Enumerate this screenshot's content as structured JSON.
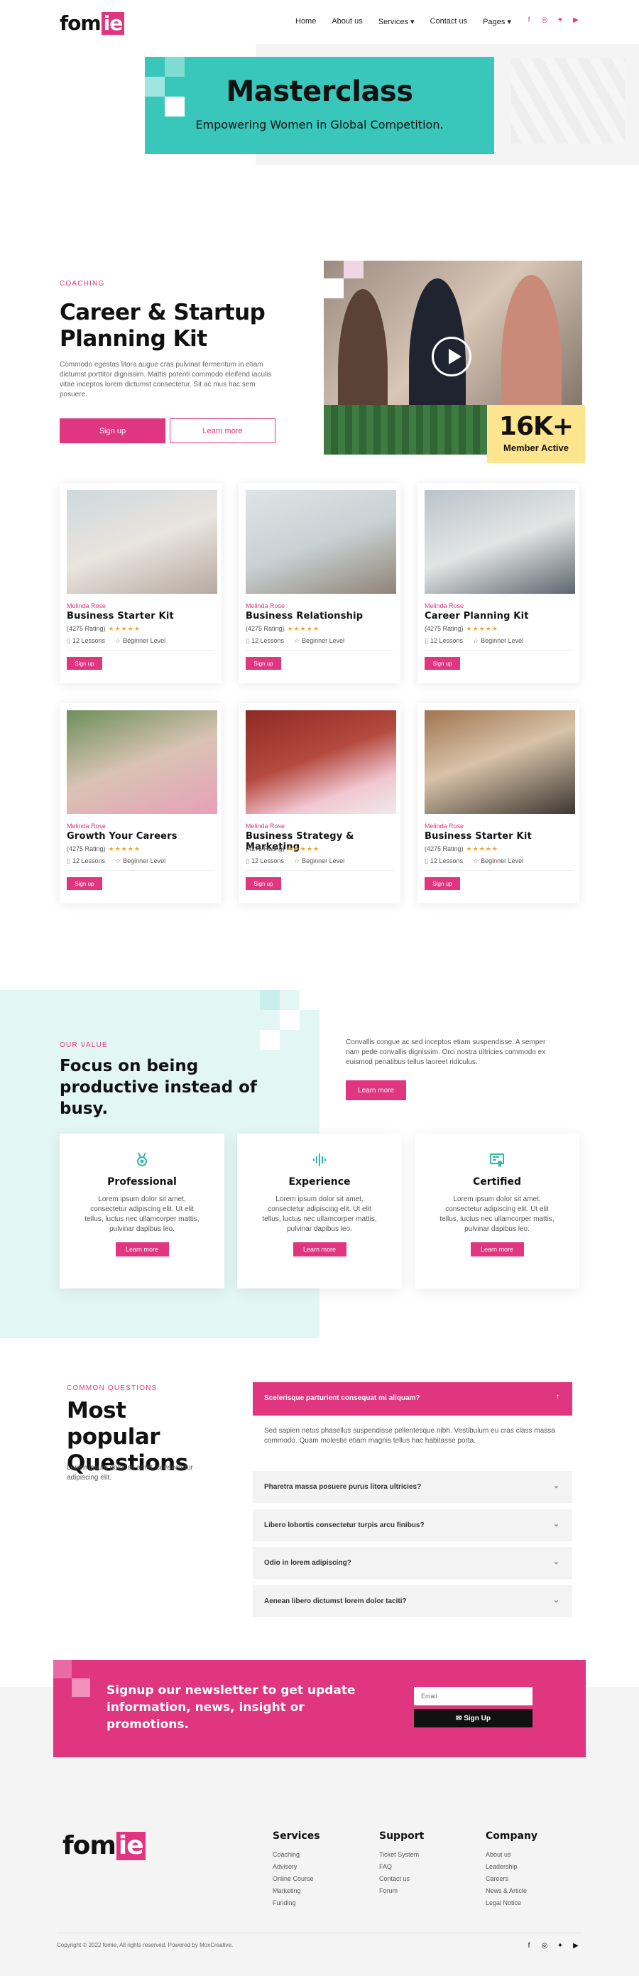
{
  "header": {
    "logo_text": "fom",
    "logo_accent": "ie",
    "nav": [
      {
        "label": "Home"
      },
      {
        "label": "About us"
      },
      {
        "label": "Services ▾"
      },
      {
        "label": "Contact us"
      },
      {
        "label": "Pages ▾"
      }
    ]
  },
  "hero": {
    "title": "Masterclass",
    "subtitle": "Empowering Women in Global Competition."
  },
  "coaching": {
    "eyebrow": "COACHING",
    "title": "Career & Startup Planning Kit",
    "text": "Commodo egestas litora augue cras pulvinar fermentum in etiam dictumst porttitor dignissim. Mattis potenti commodo eleifend iaculis vitae inceptos lorem dictumst consectetur. Sit ac mus hac sem posuere.",
    "primary_button": "Sign up",
    "secondary_button": "Learn more",
    "stat_number": "16K+",
    "stat_label": "Member Active"
  },
  "courses": [
    {
      "author": "Melinda Rose",
      "title": "Business Starter Kit",
      "rating": "(4275 Rating)",
      "stars": "★★★★★",
      "lessons": "12 Lessons",
      "level": "Beginner Level",
      "button": "Sign up"
    },
    {
      "author": "Melinda Rose",
      "title": "Business Relationship",
      "rating": "(4275 Rating)",
      "stars": "★★★★★",
      "lessons": "12 Lessons",
      "level": "Beginner Level",
      "button": "Sign up"
    },
    {
      "author": "Melinda Rose",
      "title": "Career Planning Kit",
      "rating": "(4275 Rating)",
      "stars": "★★★★★",
      "lessons": "12 Lessons",
      "level": "Beginner Level",
      "button": "Sign up"
    },
    {
      "author": "Melinda Rose",
      "title": "Growth Your Careers",
      "rating": "(4275 Rating)",
      "stars": "★★★★★",
      "lessons": "12 Lessons",
      "level": "Beginner Level",
      "button": "Sign up"
    },
    {
      "author": "Melinda Rose",
      "title": "Business Strategy & Marketing",
      "rating": "(4275 Rating)",
      "stars": "★★★★★",
      "lessons": "12 Lessons",
      "level": "Beginner Level",
      "button": "Sign up"
    },
    {
      "author": "Melinda Rose",
      "title": "Business Starter Kit",
      "rating": "(4275 Rating)",
      "stars": "★★★★★",
      "lessons": "12 Lessons",
      "level": "Beginner Level",
      "button": "Sign up"
    }
  ],
  "value": {
    "eyebrow": "OUR VALUE",
    "title": "Focus on being productive instead of busy.",
    "text": "Convallis congue ac sed inceptos etiam suspendisse. A semper nam pede convallis dignissim. Orci nostra ultricies commodo ex euismod penatibus tellus laoreet ridiculus.",
    "button": "Learn more",
    "cards": [
      {
        "icon": "medal-icon",
        "title": "Professional",
        "text": "Lorem ipsum dolor sit amet, consectetur adipiscing elit. Ut elit tellus, luctus nec ullamcorper mattis, pulvinar dapibus leo.",
        "button": "Learn more"
      },
      {
        "icon": "sound-wave-icon",
        "title": "Experience",
        "text": "Lorem ipsum dolor sit amet, consectetur adipiscing elit. Ut elit tellus, luctus nec ullamcorper mattis, pulvinar dapibus leo.",
        "button": "Learn more"
      },
      {
        "icon": "certificate-icon",
        "title": "Certified",
        "text": "Lorem ipsum dolor sit amet, consectetur adipiscing elit. Ut elit tellus, luctus nec ullamcorper mattis, pulvinar dapibus leo.",
        "button": "Learn more"
      }
    ]
  },
  "faq": {
    "eyebrow": "COMMON QUESTIONS",
    "title": "Most popular Questions",
    "text": "Lorem ipsum dolor sit amet, consectetur adipiscing elit.",
    "open_question": "Scelerisque parturient consequat mi aliquam?",
    "open_answer": "Sed sapien netus phasellus suspendisse pellentesque nibh. Vestibulum eu cras class massa commodo. Quam molestie etiam magnis tellus hac habitasse porta.",
    "questions": [
      "Pharetra massa posuere purus litora ultricies?",
      "Libero lobortis consectetur turpis arcu finibus?",
      "Odio in lorem adipiscing?",
      "Aenean libero dictumst lorem dolor taciti?"
    ]
  },
  "newsletter": {
    "title": "Signup our newsletter to get update information, news, insight or promotions.",
    "email_placeholder": "Email",
    "button": "✉ Sign Up"
  },
  "footer": {
    "columns": [
      {
        "title": "Services",
        "links": [
          "Coaching",
          "Advisory",
          "Online Course",
          "Marketing",
          "Funding"
        ]
      },
      {
        "title": "Support",
        "links": [
          "Ticket System",
          "FAQ",
          "Contact us",
          "Forum"
        ]
      },
      {
        "title": "Company",
        "links": [
          "About us",
          "Leadership",
          "Careers",
          "News & Article",
          "Legal Notice"
        ]
      }
    ],
    "copyright": "Copyright © 2022 fomie, All rights reserved. Powered by MoxCreative."
  },
  "colors": {
    "accent": "#e0357f",
    "teal": "#38c7ba",
    "yellow": "#fde48e"
  }
}
